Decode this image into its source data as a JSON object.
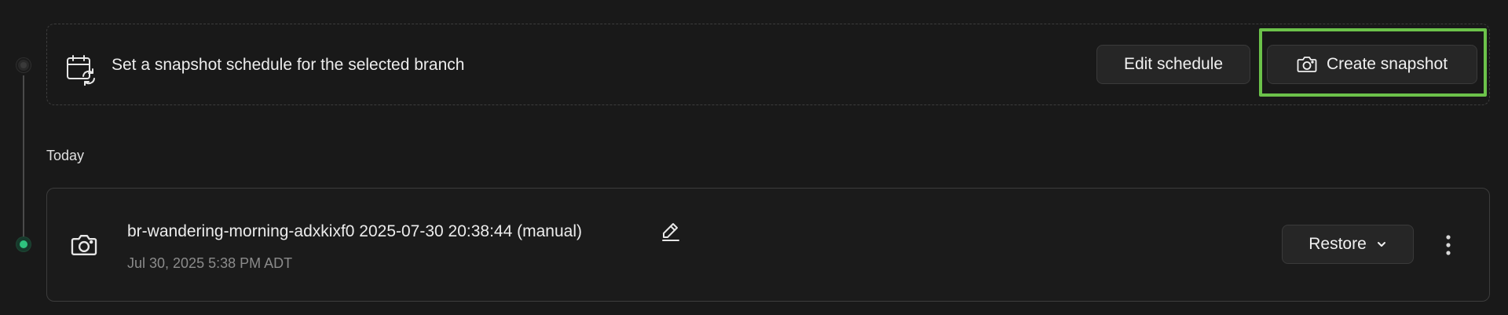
{
  "schedule": {
    "text": "Set a snapshot schedule for the selected branch",
    "icon": "calendar-refresh-icon",
    "edit_label": "Edit schedule",
    "create_label": "Create snapshot",
    "create_icon": "camera-icon",
    "highlight_color": "#6cc24a"
  },
  "section": {
    "today_label": "Today"
  },
  "snapshot": {
    "icon": "camera-icon",
    "title": "br-wandering-morning-adxkixf0 2025-07-30 20:38:44 (manual)",
    "edit_icon": "pencil-icon",
    "time": "Jul 30, 2025 5:38 PM ADT",
    "restore_label": "Restore",
    "restore_icon": "chevron-down-icon",
    "more_icon": "more-vertical-icon"
  },
  "colors": {
    "background": "#191919",
    "active_dot": "#2ec47f"
  }
}
